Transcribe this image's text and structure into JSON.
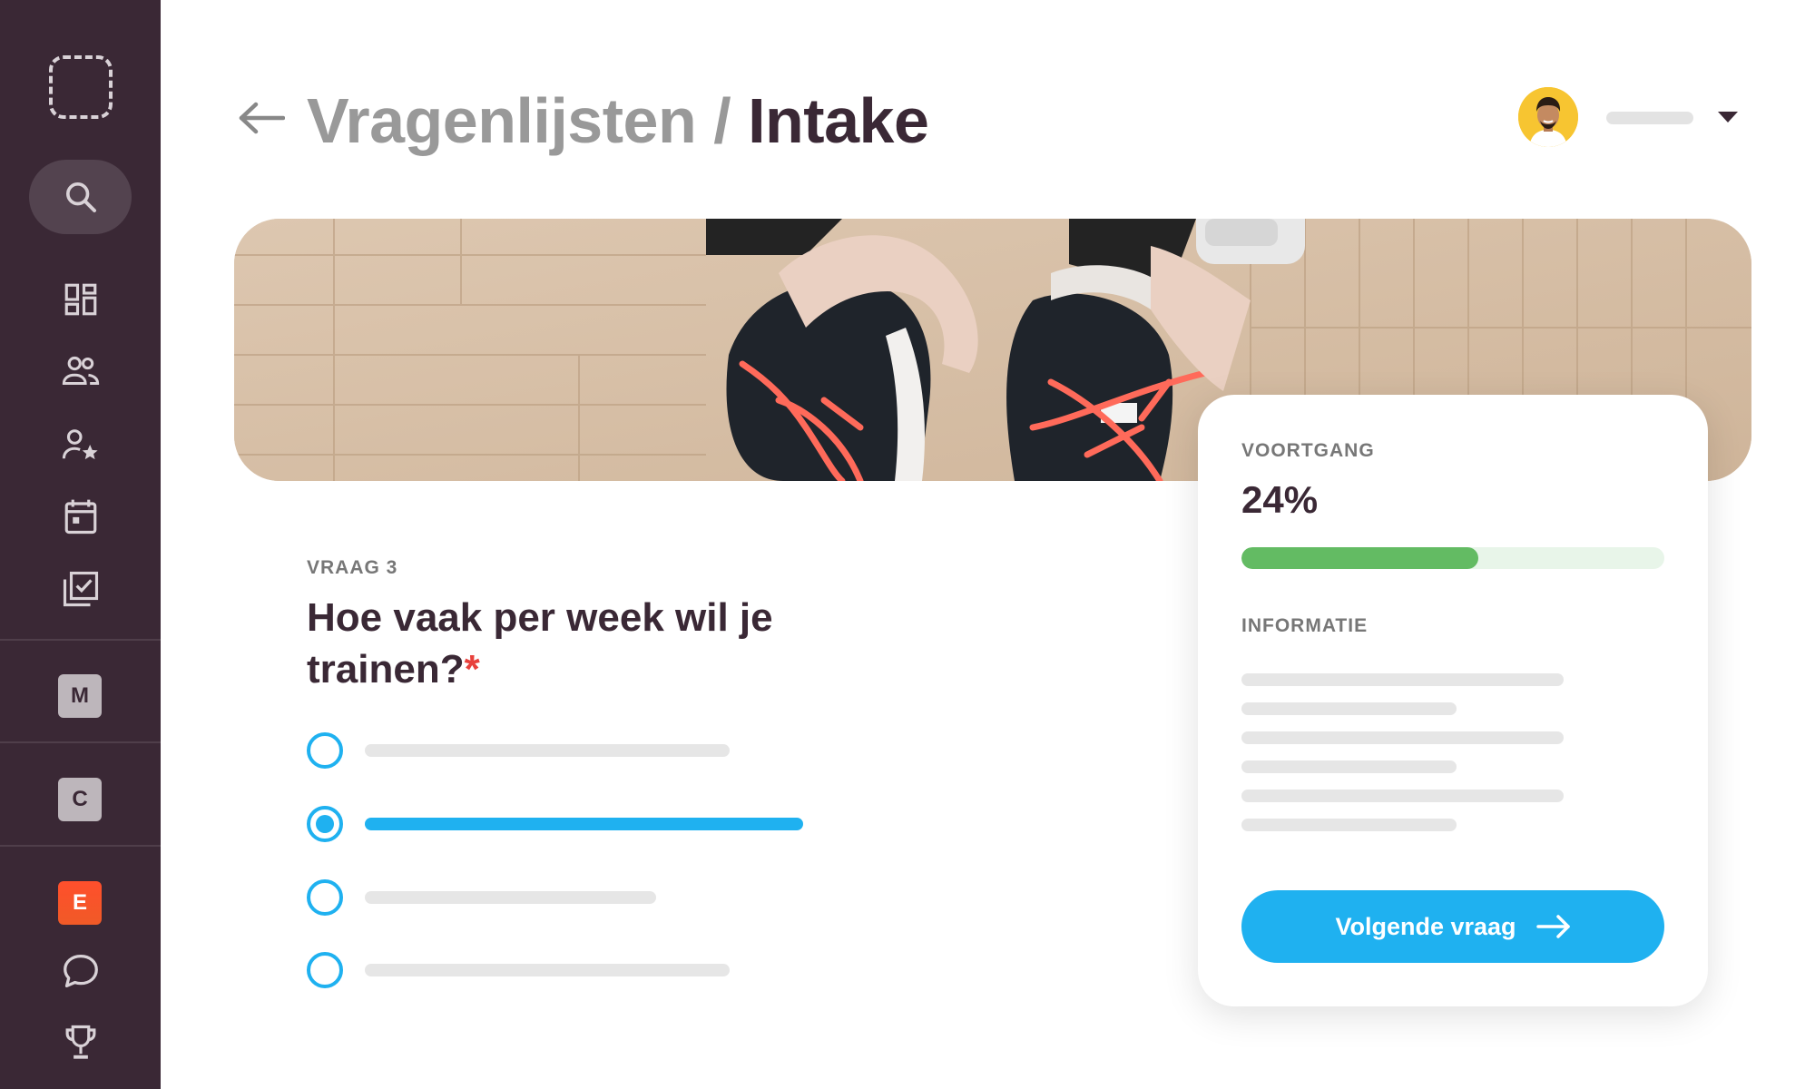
{
  "header": {
    "breadcrumb_parent": "Vragenlijsten",
    "breadcrumb_separator": "/",
    "breadcrumb_current": "Intake"
  },
  "sidebar": {
    "items": [
      {
        "icon": "search-icon"
      },
      {
        "icon": "dashboard-icon"
      },
      {
        "icon": "users-icon"
      },
      {
        "icon": "user-star-icon"
      },
      {
        "icon": "calendar-icon"
      },
      {
        "icon": "checklist-icon"
      },
      {
        "label": "M"
      },
      {
        "label": "C"
      },
      {
        "label": "E"
      },
      {
        "icon": "chat-icon"
      },
      {
        "icon": "trophy-icon"
      }
    ]
  },
  "question": {
    "label": "VRAAG 3",
    "title": "Hoe vaak per week wil je trainen?",
    "required_marker": "*",
    "selected_option_index": 1,
    "option_count": 4
  },
  "progress_card": {
    "progress_heading": "VOORTGANG",
    "progress_value": "24%",
    "progress_fraction": 0.56,
    "info_heading": "INFORMATIE",
    "next_button_label": "Volgende vraag"
  },
  "colors": {
    "sidebar_bg": "#3a2835",
    "accent_blue": "#1fb1f0",
    "progress_green": "#63bb63",
    "required_red": "#e8413c",
    "badge_e": "#ff4f2c"
  }
}
